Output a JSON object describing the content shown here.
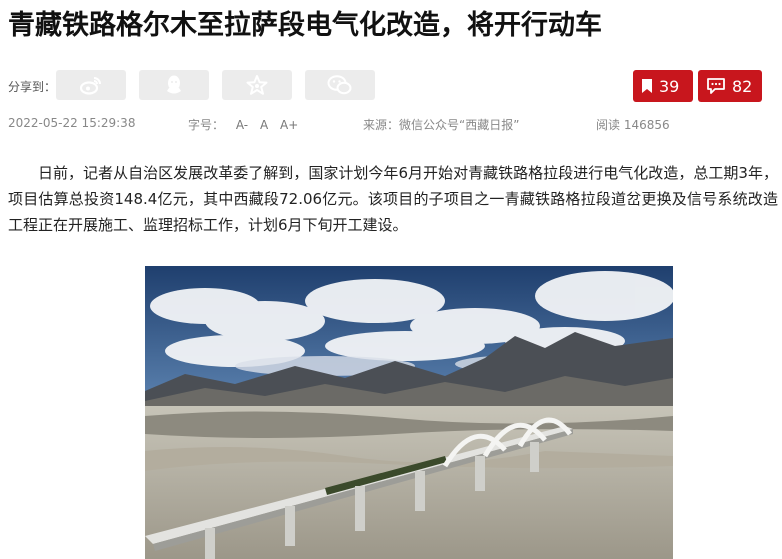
{
  "article": {
    "title": "青藏铁路格尔木至拉萨段电气化改造，将开行动车",
    "share_label": "分享到：",
    "share_targets": [
      "weibo-icon",
      "qq-icon",
      "star-icon",
      "wechat-icon"
    ],
    "bookmark_count": "39",
    "comment_count": "82",
    "date": "2022-05-22 15:29:38",
    "font_size_label": "字号：",
    "font_smaller": "A-",
    "font_normal": "A",
    "font_larger": "A+",
    "source": "来源：微信公众号“西藏日报”",
    "views": "阅读 146856",
    "paragraph": "日前，记者从自治区发展改革委了解到，国家计划今年6月开始对青藏铁路格拉段进行电气化改造，总工期3年，项目估算总投资148.4亿元，其中西藏段72.06亿元。该项目的子项目之一青藏铁路格拉段道岔更换及信号系统改造工程正在开展施工、监理招标工作，计划6月下旬开工建设。"
  },
  "colors": {
    "accent": "#c8161d",
    "share_bg": "#ececec",
    "meta": "#888888"
  }
}
